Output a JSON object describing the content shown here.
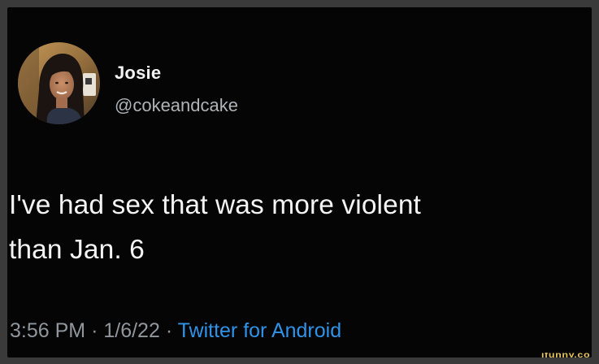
{
  "tweet": {
    "display_name": "Josie",
    "handle": "@cokeandcake",
    "text": "I've had sex that was more violent\nthan Jan. 6",
    "time": "3:56 PM",
    "separator": "·",
    "date": "1/6/22",
    "source": "Twitter for Android"
  },
  "watermark": "ifunny.co",
  "colors": {
    "background": "#050505",
    "name": "#f2f2f2",
    "handle": "#aeb3b8",
    "body_text": "#f4f4f4",
    "meta": "#8f969c",
    "link": "#2f93e8"
  }
}
